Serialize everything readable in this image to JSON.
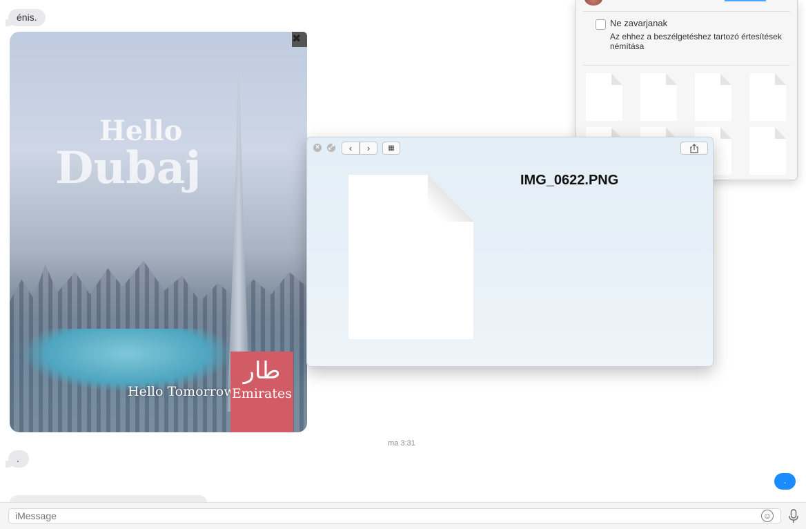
{
  "chat": {
    "messages": [
      {
        "text": "énis."
      },
      {
        "text": "."
      }
    ],
    "image_message": {
      "hello": "Hello",
      "city": "Dubaj",
      "tagline": "Hello Tomorrow",
      "brand_glyph": "ﻃﺎﺭ",
      "brand": "Emirates"
    },
    "timestamp": "ma 3:31",
    "outgoing_text": "."
  },
  "input": {
    "placeholder": "iMessage"
  },
  "details": {
    "dnd_label": "Ne zavarjanak",
    "dnd_desc": "Az ehhez a beszélgetéshez tartozó értesítések némítása",
    "attachment_count": 8
  },
  "quicklook": {
    "filename": "IMG_0622.PNG"
  },
  "colors": {
    "accent": "#1a8cff",
    "bubble_in": "#e9e9eb",
    "brand_red": "#d15c66"
  }
}
